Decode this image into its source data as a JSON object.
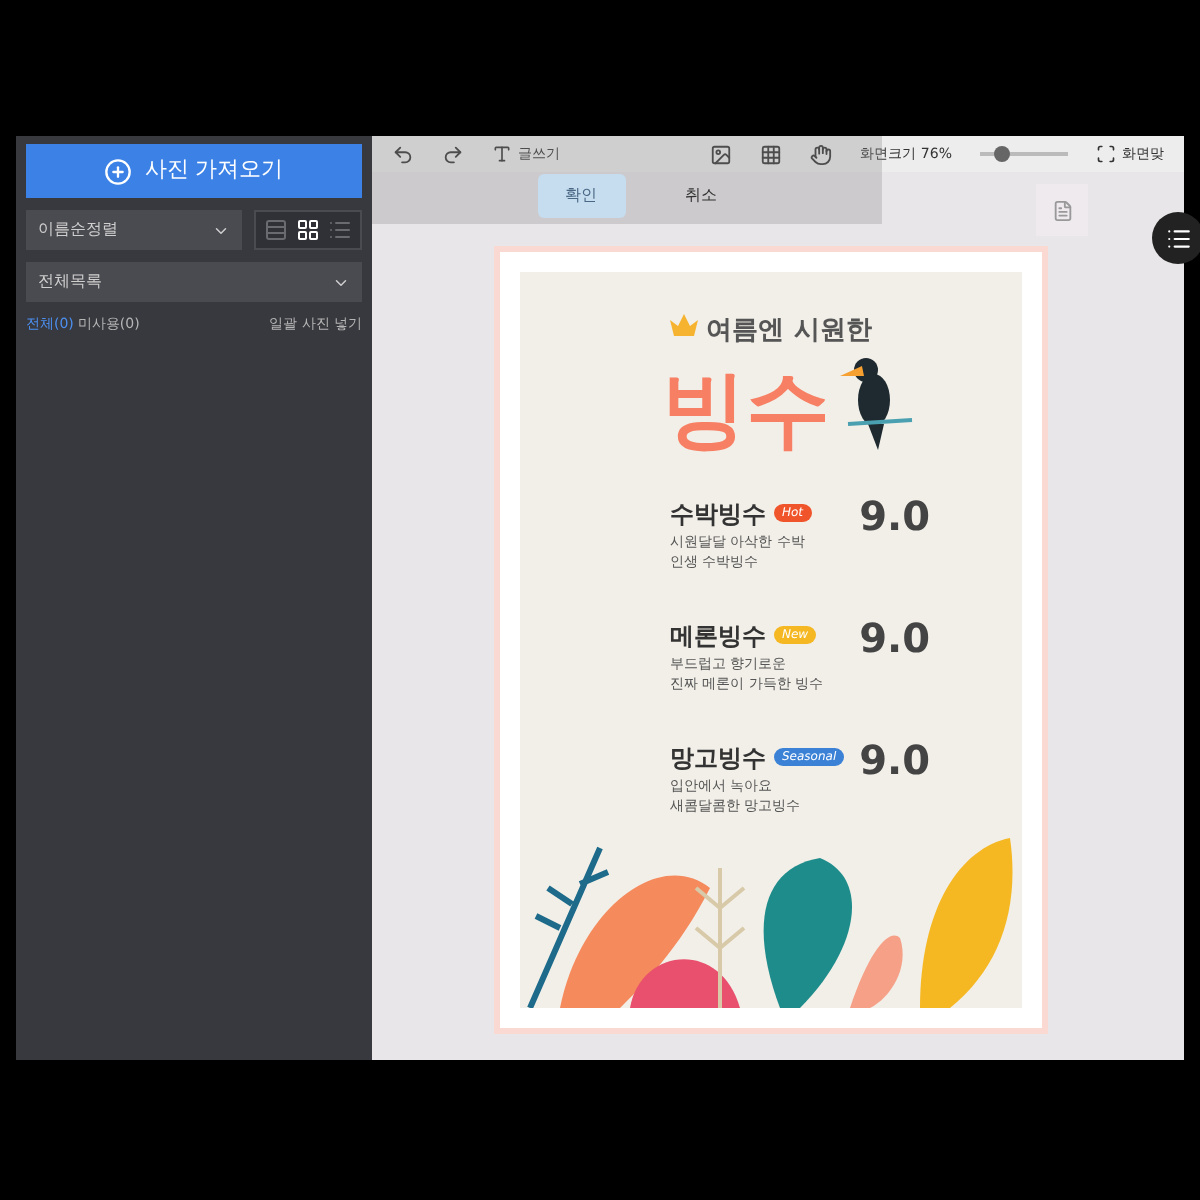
{
  "sidebar": {
    "import_button": "사진 가져오기",
    "sort_select": "이름순정렬",
    "view_buttons": [
      {
        "kind": "list-small",
        "selected": false
      },
      {
        "kind": "grid",
        "selected": true
      },
      {
        "kind": "list",
        "selected": false
      }
    ],
    "folder_select": "전체목록",
    "filters": [
      {
        "label": "전체(0)",
        "selected": true
      },
      {
        "label": "미사용(0)",
        "selected": false
      }
    ],
    "bulk_insert": "일괄 사진 넣기"
  },
  "toolbar": {
    "text_tool": "글쓰기",
    "zoom_label": "화면크기 76%",
    "zoom": {
      "level": 0.25
    },
    "fit": "화면맞"
  },
  "popup": {
    "confirm": "확인",
    "cancel": "취소"
  },
  "poster": {
    "subtitle": "여름엔 시원한",
    "title": "빙수",
    "items": [
      {
        "name": "수박빙수",
        "tag": "Hot",
        "color": "#f0542a",
        "lines": [
          "시원달달 아삭한 수박",
          "인생 수박빙수"
        ],
        "price": "9.0"
      },
      {
        "name": "메론빙수",
        "tag": "New",
        "color": "#f5b722",
        "lines": [
          "부드럽고 향기로운",
          "진짜 메론이 가득한 빙수"
        ],
        "price": "9.0"
      },
      {
        "name": "망고빙수",
        "tag": "Seasonal",
        "color": "#3b82d6",
        "lines": [
          "입안에서 녹아요",
          "새콤달콤한 망고빙수"
        ],
        "price": "9.0"
      }
    ]
  }
}
